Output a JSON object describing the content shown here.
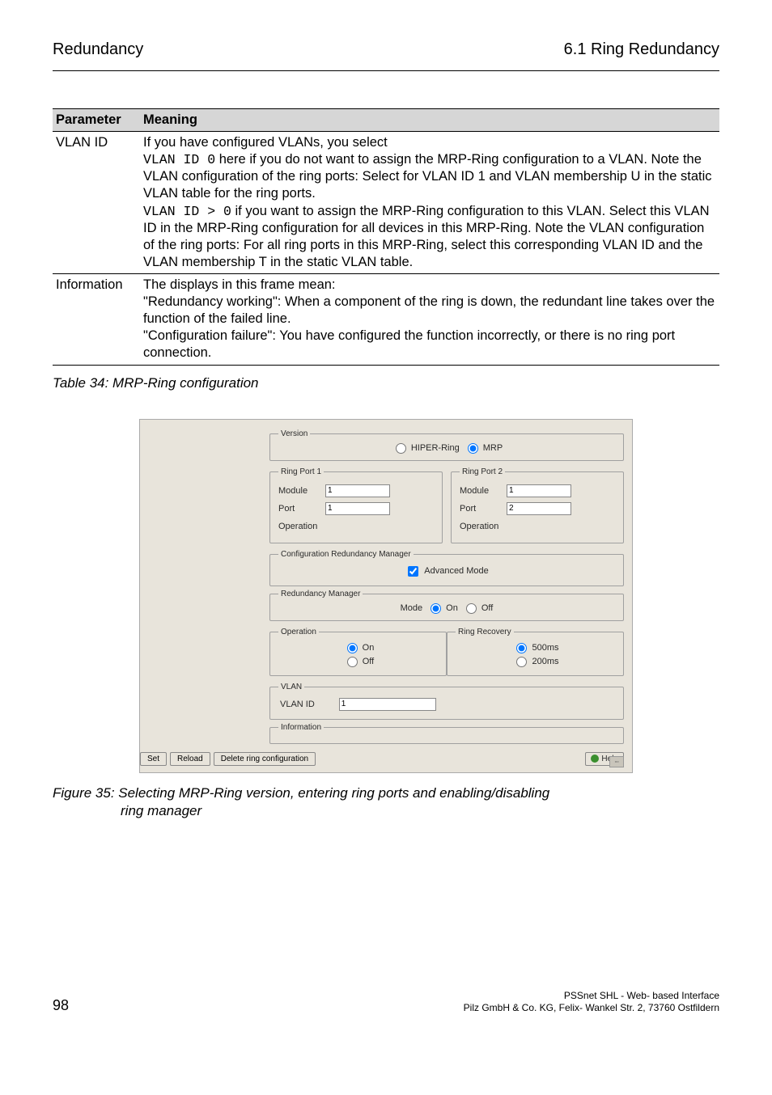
{
  "header": {
    "left": "Redundancy",
    "right": "6.1 Ring Redundancy"
  },
  "table": {
    "headers": [
      "Parameter",
      "Meaning"
    ],
    "rows": [
      {
        "param": "VLAN ID",
        "lines": {
          "l0": "If you have configured VLANs, you select",
          "c1": "VLAN ID 0",
          "l1": " here if you do not want to assign the MRP-Ring configuration to a VLAN. Note the VLAN configuration of the ring ports: Select for VLAN ID 1 and VLAN membership U in the static VLAN table for the ring ports.",
          "c2": "VLAN ID > 0",
          "l2": " if you want to assign the MRP-Ring configuration to this VLAN. Select this VLAN ID in the MRP-Ring configuration for all devices in this MRP-Ring. Note the VLAN configuration of the ring ports: For all ring ports in this MRP-Ring, select this corresponding VLAN ID and the VLAN membership T in the static VLAN table."
        }
      },
      {
        "param": "Information",
        "lines": {
          "t": "The displays in this frame mean:\n\"Redundancy working\": When a component of the ring is down, the redundant line takes over the function of the failed line.\n\"Configuration failure\": You have configured the function incorrectly, or there is no ring port connection."
        }
      }
    ]
  },
  "caption1": "Table 34: MRP-Ring configuration",
  "shot": {
    "version": {
      "legend": "Version",
      "opt1": "HIPER-Ring",
      "opt2": "MRP"
    },
    "ringport1": {
      "legend": "Ring Port 1",
      "module": "Module",
      "module_v": "1",
      "port": "Port",
      "port_v": "1",
      "op": "Operation"
    },
    "ringport2": {
      "legend": "Ring Port 2",
      "module": "Module",
      "module_v": "1",
      "port": "Port",
      "port_v": "2",
      "op": "Operation"
    },
    "crm": {
      "legend": "Configuration Redundancy Manager",
      "adv": "Advanced Mode"
    },
    "rm": {
      "legend": "Redundancy Manager",
      "mode": "Mode",
      "on": "On",
      "off": "Off"
    },
    "operation": {
      "legend": "Operation",
      "on": "On",
      "off": "Off"
    },
    "recovery": {
      "legend": "Ring Recovery",
      "a": "500ms",
      "b": "200ms"
    },
    "vlan": {
      "legend": "VLAN",
      "label": "VLAN ID",
      "value": "1"
    },
    "info": {
      "legend": "Information"
    },
    "buttons": {
      "set": "Set",
      "reload": "Reload",
      "delete": "Delete ring configuration",
      "help": "Help"
    }
  },
  "caption2": {
    "a": "Figure 35: Selecting MRP-Ring version, entering ring ports and enabling/disabling",
    "b": "ring manager"
  },
  "footer": {
    "page": "98",
    "line1": "PSSnet SHL - Web- based Interface",
    "line2": "Pilz GmbH & Co. KG, Felix- Wankel Str. 2, 73760 Ostfildern"
  }
}
